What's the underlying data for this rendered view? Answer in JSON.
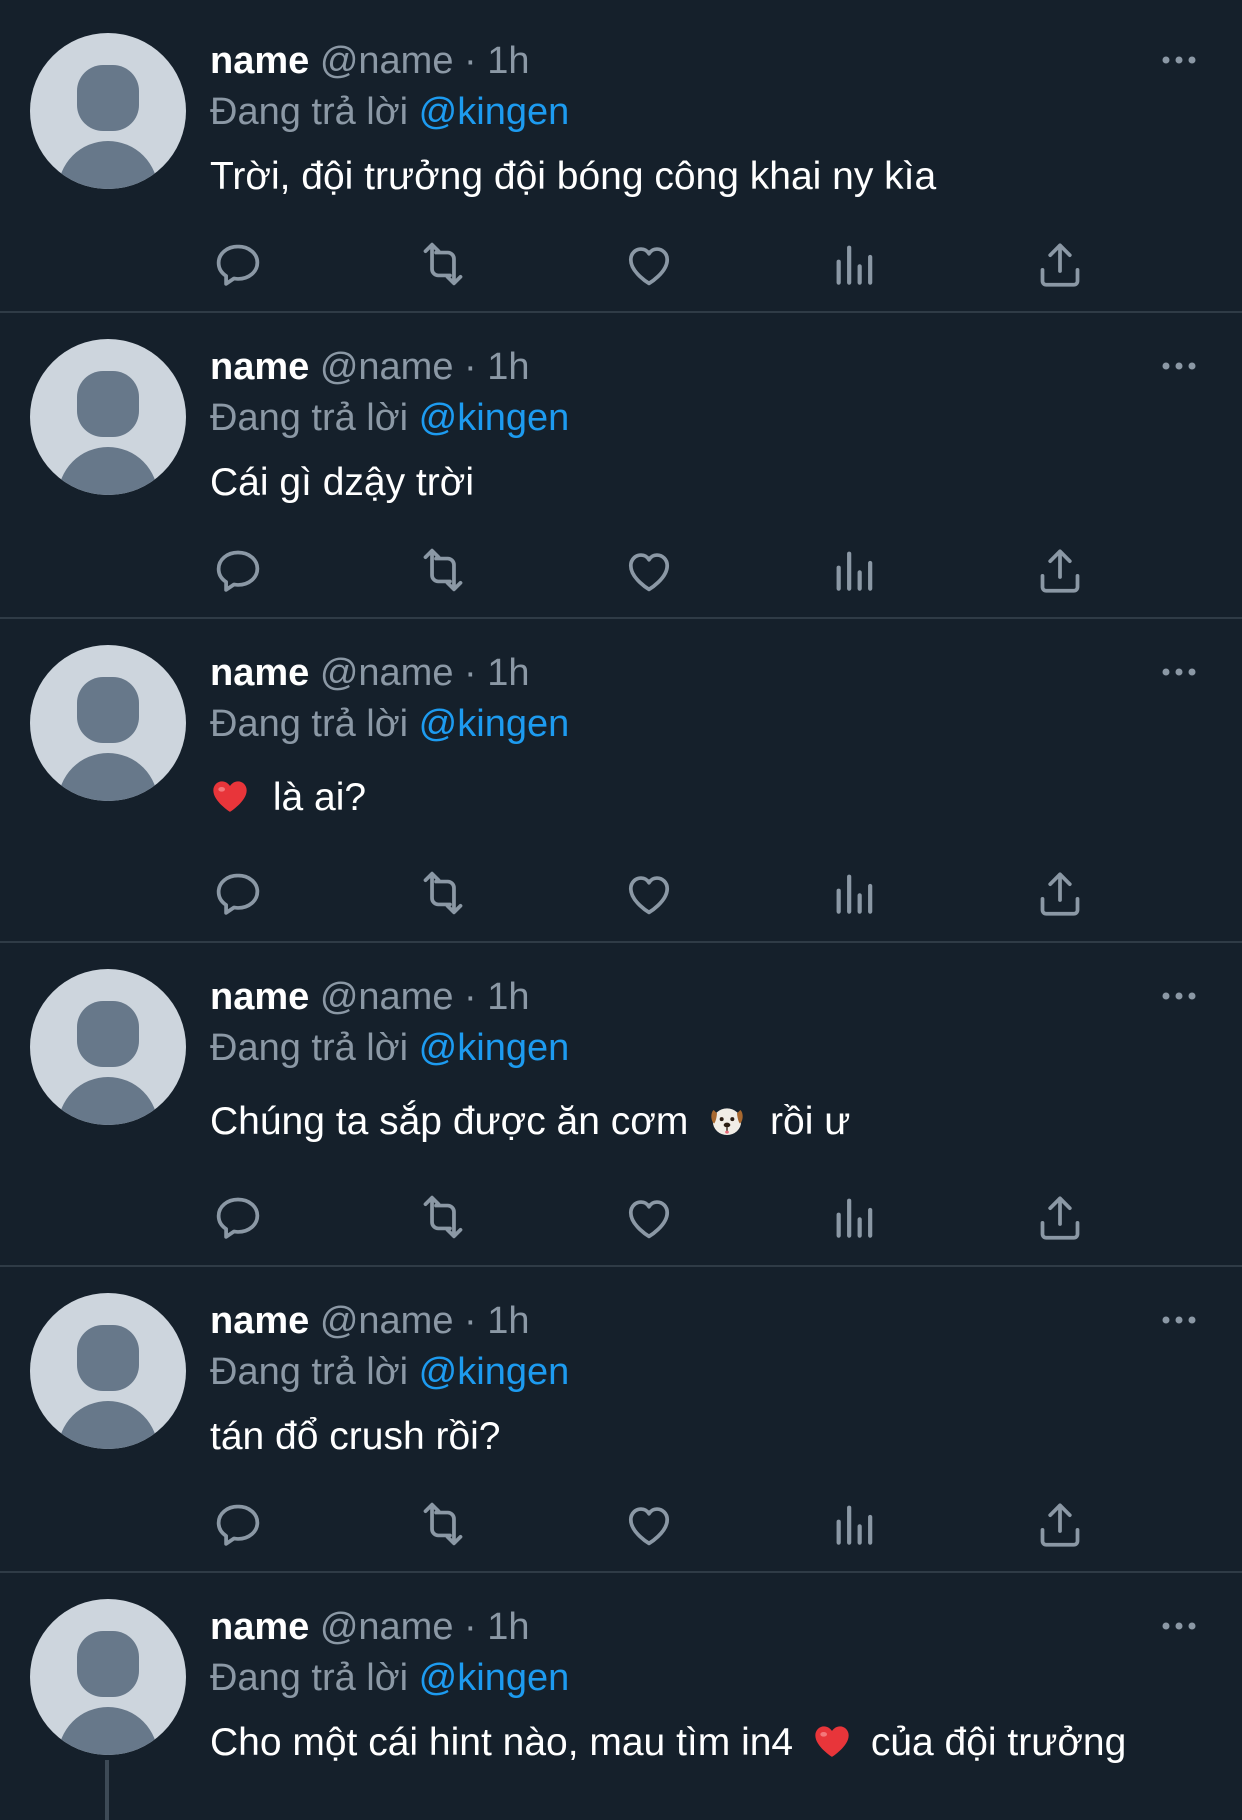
{
  "colors": {
    "background": "#15202b",
    "text": "#ffffff",
    "secondary": "#8b98a5",
    "accent": "#1d9bf0",
    "divider": "#2f3b46"
  },
  "replies": [
    {
      "name": "name",
      "handle": "@name",
      "dot": "·",
      "time": "1h",
      "replying_label": "Đang trả lời",
      "mention": "@kingen",
      "text": "Trời, đội trưởng đội bóng công khai ny kìa"
    },
    {
      "name": "name",
      "handle": "@name",
      "dot": "·",
      "time": "1h",
      "replying_label": "Đang trả lời",
      "mention": "@kingen",
      "text": "Cái gì dzậy trời"
    },
    {
      "name": "name",
      "handle": "@name",
      "dot": "·",
      "time": "1h",
      "replying_label": "Đang trả lời",
      "mention": "@kingen",
      "text_after_emoji": "là ai?",
      "emoji": "heart-emoji"
    },
    {
      "name": "name",
      "handle": "@name",
      "dot": "·",
      "time": "1h",
      "replying_label": "Đang trả lời",
      "mention": "@kingen",
      "text_before_emoji": "Chúng ta sắp được ăn cơm",
      "text_after_emoji": "rồi ư",
      "emoji": "dog-face-emoji"
    },
    {
      "name": "name",
      "handle": "@name",
      "dot": "·",
      "time": "1h",
      "replying_label": "Đang trả lời",
      "mention": "@kingen",
      "text": "tán đổ crush rồi?"
    },
    {
      "name": "name",
      "handle": "@name",
      "dot": "·",
      "time": "1h",
      "replying_label": "Đang trả lời",
      "mention": "@kingen",
      "text_before_emoji": "Cho một cái hint nào, mau tìm in4",
      "text_after_emoji": "của đội trưởng",
      "emoji": "heart-emoji"
    }
  ],
  "icons": [
    "more-icon",
    "reply-icon",
    "retweet-icon",
    "like-icon",
    "views-icon",
    "share-icon"
  ]
}
